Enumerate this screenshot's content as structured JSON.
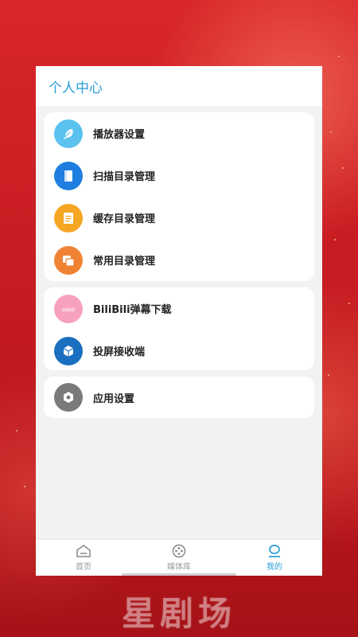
{
  "header": {
    "title": "个人中心"
  },
  "groups": [
    [
      {
        "label": "播放器设置",
        "icon": "feather-icon",
        "color": "#5bc2ef"
      },
      {
        "label": "扫描目录管理",
        "icon": "book-icon",
        "color": "#1e7fe0"
      },
      {
        "label": "缓存目录管理",
        "icon": "document-icon",
        "color": "#f5a623"
      },
      {
        "label": "常用目录管理",
        "icon": "folders-icon",
        "color": "#f08333"
      }
    ],
    [
      {
        "label": "BiliBili弹幕下载",
        "icon": "bilibili-icon",
        "color": "#f7a1bf"
      },
      {
        "label": "投屏接收端",
        "icon": "cube-icon",
        "color": "#1a6fc0"
      }
    ],
    [
      {
        "label": "应用设置",
        "icon": "settings-icon",
        "color": "#7a7a7a"
      }
    ]
  ],
  "nav": {
    "home": "首页",
    "media": "媒体库",
    "mine": "我的"
  },
  "watermark": "星剧场",
  "colors": {
    "accent": "#2a9fd8",
    "background": "#c81c22"
  }
}
